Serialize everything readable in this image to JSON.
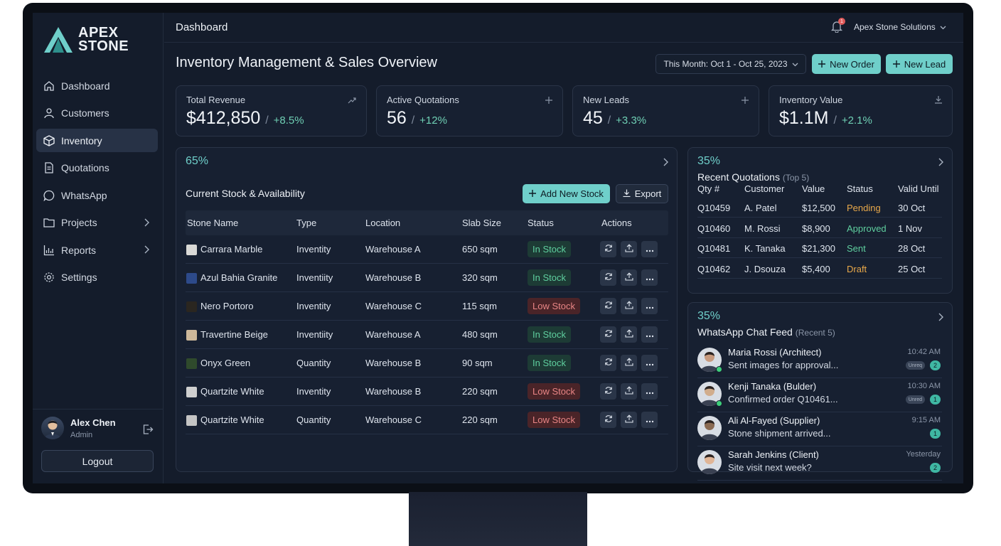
{
  "brand": {
    "line1": "APEX",
    "line2": "STONE",
    "accent": "#6fcfca"
  },
  "sidebar": {
    "items": [
      {
        "label": "Dashboard",
        "icon": "home-icon"
      },
      {
        "label": "Customers",
        "icon": "user-icon"
      },
      {
        "label": "Inventory",
        "icon": "box-icon",
        "active": true
      },
      {
        "label": "Quotations",
        "icon": "document-icon"
      },
      {
        "label": "WhatsApp",
        "icon": "whatsapp-icon"
      },
      {
        "label": "Projects",
        "icon": "folder-icon",
        "expandable": true
      },
      {
        "label": "Reports",
        "icon": "bar-chart-icon",
        "expandable": true
      },
      {
        "label": "Settings",
        "icon": "gear-icon"
      }
    ],
    "user": {
      "name": "Alex Chen",
      "role": "Admin"
    },
    "logout_label": "Logout"
  },
  "header": {
    "title": "Dashboard",
    "notifications": "1",
    "company": "Apex Stone Solutions"
  },
  "page": {
    "title": "Inventory Management & Sales Overview",
    "date_range": "This Month: Oct 1 - Oct 25, 2023",
    "new_order": "New Order",
    "new_lead": "New Lead"
  },
  "kpis": [
    {
      "label": "Total Revenue",
      "value": "$412,850",
      "delta": "+8.5%",
      "icon": "trend-icon"
    },
    {
      "label": "Active Quotations",
      "value": "56",
      "delta": "+12%",
      "icon": "plus-icon"
    },
    {
      "label": "New Leads",
      "value": "45",
      "delta": "+3.3%",
      "icon": "plus-icon"
    },
    {
      "label": "Inventory Value",
      "value": "$1.1M",
      "delta": "+2.1%",
      "icon": "download-icon"
    }
  ],
  "stock": {
    "percent": "65%",
    "title": "Current Stock & Availability",
    "add_label": "Add New Stock",
    "export_label": "Export",
    "columns": [
      "Stone Name",
      "Type",
      "Location",
      "Slab Size",
      "Status",
      "Actions"
    ],
    "rows": [
      {
        "name": "Carrara Marble",
        "type": "Inventity",
        "location": "Warehouse A",
        "size": "650 sqm",
        "status": "In Stock",
        "level": "in",
        "swatch": "#d9d9d6"
      },
      {
        "name": "Azul Bahia Granite",
        "type": "Inventiity",
        "location": "Warehouse B",
        "size": "320 sqm",
        "status": "In Stock",
        "level": "in",
        "swatch": "#2d4a8a"
      },
      {
        "name": "Nero Portoro",
        "type": "Inventity",
        "location": "Warehouse C",
        "size": "115 sqm",
        "status": "Low Stock",
        "level": "low",
        "swatch": "#2a2620"
      },
      {
        "name": "Travertine Beige",
        "type": "Inventiity",
        "location": "Warehouse A",
        "size": "480 sqm",
        "status": "In Stock",
        "level": "in",
        "swatch": "#cdb89a"
      },
      {
        "name": "Onyx Green",
        "type": "Quantity",
        "location": "Warehouse B",
        "size": "90 sqm",
        "status": "In Stock",
        "level": "in",
        "swatch": "#2f4a2c"
      },
      {
        "name": "Quartzite White",
        "type": "Inventity",
        "location": "Warehouse B",
        "size": "220 sqm",
        "status": "Low Stock",
        "level": "low",
        "swatch": "#cfcfcf"
      },
      {
        "name": "Quartzite White",
        "type": "Quantity",
        "location": "Warehouse C",
        "size": "220 sqm",
        "status": "Low Stock",
        "level": "low",
        "swatch": "#c4c4c4"
      }
    ]
  },
  "quotations": {
    "percent": "35%",
    "title": "Recent Quotations",
    "subtitle": "(Top 5)",
    "columns": [
      "Qty #",
      "Customer",
      "Value",
      "Status",
      "Valid Until"
    ],
    "rows": [
      {
        "id": "Q10459",
        "customer": "A. Patel",
        "value": "$12,500",
        "status": "Pending",
        "color": "#e8a84a",
        "valid": "30 Oct"
      },
      {
        "id": "Q10460",
        "customer": "M. Rossi",
        "value": "$8,900",
        "status": "Approved",
        "color": "#5fcf9f",
        "valid": "1 Nov"
      },
      {
        "id": "Q10481",
        "customer": "K. Tanaka",
        "value": "$21,300",
        "status": "Sent",
        "color": "#5fcf9f",
        "valid": "28 Oct"
      },
      {
        "id": "Q10462",
        "customer": "J. Dsouza",
        "value": "$5,400",
        "status": "Draft",
        "color": "#e8a84a",
        "valid": "25 Oct"
      }
    ]
  },
  "whatsapp": {
    "percent": "35%",
    "title": "WhatsApp Chat Feed",
    "subtitle": "(Recent 5)",
    "chats": [
      {
        "name": "Maria Rossi (Architect)",
        "message": "Sent images for approval...",
        "time": "10:42 AM",
        "tag": "Unreq",
        "count": "2",
        "online": true,
        "avatar": "#c79a7e"
      },
      {
        "name": "Kenji Tanaka (Bulder)",
        "message": "Confirmed order Q10461...",
        "time": "10:30 AM",
        "tag": "Unred",
        "count": "1",
        "online": true,
        "avatar": "#d1ad8c"
      },
      {
        "name": "Ali Al-Fayed (Supplier)",
        "message": "Stone shipment arrived...",
        "time": "9:15 AM",
        "tag": "",
        "count": "1",
        "online": false,
        "avatar": "#8a6a52"
      },
      {
        "name": "Sarah Jenkins (Client)",
        "message": "Site visit next week?",
        "time": "Yesterday",
        "tag": "",
        "count": "2",
        "online": false,
        "avatar": "#e0b596"
      }
    ]
  }
}
